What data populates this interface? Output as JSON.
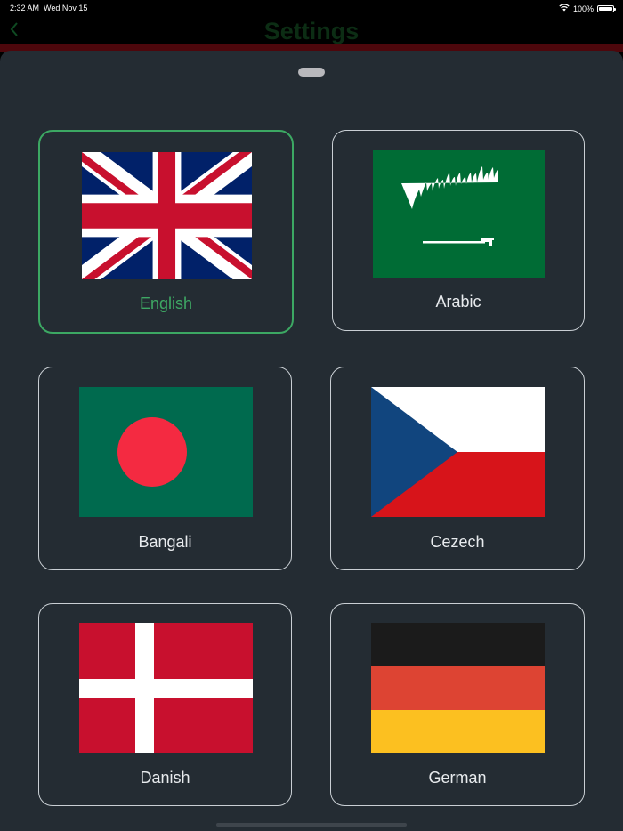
{
  "status_bar": {
    "time": "2:32 AM",
    "date": "Wed Nov 15",
    "battery": "100%"
  },
  "nav": {
    "title": "Settings",
    "back_icon": "chevron-left-icon"
  },
  "colors": {
    "sheet_bg": "#242c33",
    "selected_border": "#3ca863",
    "selected_text": "#3ea864",
    "card_border": "#c9cfd4",
    "title_color": "#0c2d14"
  },
  "languages": [
    {
      "label": "English",
      "flag": "uk-flag",
      "selected": true
    },
    {
      "label": "Arabic",
      "flag": "saudi-arabia-flag",
      "selected": false
    },
    {
      "label": "Bangali",
      "flag": "bangladesh-flag",
      "selected": false
    },
    {
      "label": "Cezech",
      "flag": "czech-republic-flag",
      "selected": false
    },
    {
      "label": "Danish",
      "flag": "denmark-flag",
      "selected": false
    },
    {
      "label": "German",
      "flag": "germany-flag",
      "selected": false
    }
  ]
}
